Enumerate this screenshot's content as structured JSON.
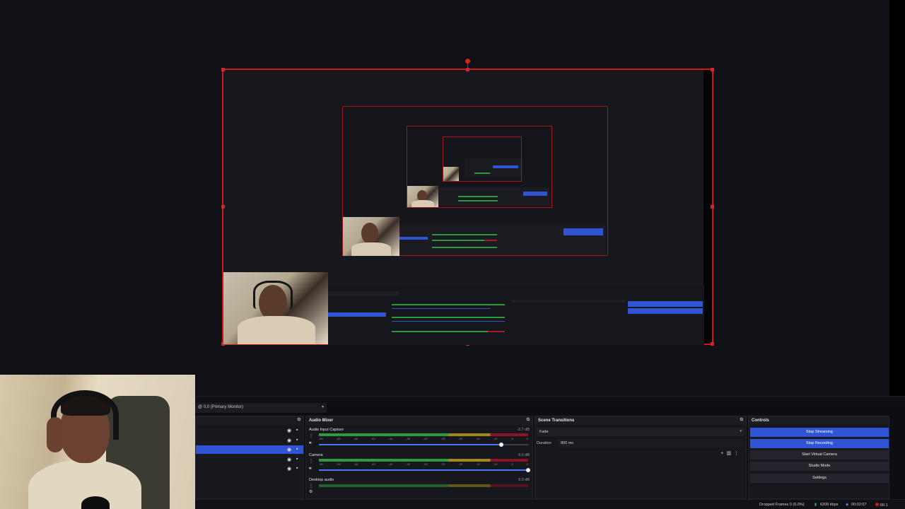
{
  "monitor": {
    "label": "@ 0,0 (Primary Monitor)"
  },
  "audio_mixer": {
    "title": "Audio Mixer",
    "ticks": [
      "-60",
      "-55",
      "-50",
      "-45",
      "-40",
      "-35",
      "-30",
      "-25",
      "-20",
      "-15",
      "-10",
      "-5",
      "0"
    ],
    "channels": [
      {
        "name": "Audio Input Capture",
        "db": "-2.7 dB",
        "volume_fraction": 0.87
      },
      {
        "name": "Camera",
        "db": "0.0 dB",
        "volume_fraction": 1.0
      },
      {
        "name": "Desktop audio",
        "db": "0.0 dB",
        "volume_fraction": 1.0
      }
    ]
  },
  "scene_transitions": {
    "title": "Scene Transitions",
    "selected": "Fade",
    "duration_label": "Duration",
    "duration_value": "800 ms"
  },
  "controls": {
    "title": "Controls",
    "buttons": [
      "Stop Streaming",
      "Stop Recording",
      "Start Virtual Camera",
      "Studio Mode",
      "Settings"
    ]
  },
  "status": {
    "dropped_frames": "Dropped Frames 0 (0.0%)",
    "bitrate": "6209 kbps",
    "stream_time": "00:02:07",
    "rec_time": "00:1"
  },
  "colors": {
    "accent": "#2f55d4",
    "selection_border": "#d01818",
    "meter_green": "#2f9a3a",
    "meter_yellow": "#a08a1a",
    "meter_red": "#8a1424"
  }
}
